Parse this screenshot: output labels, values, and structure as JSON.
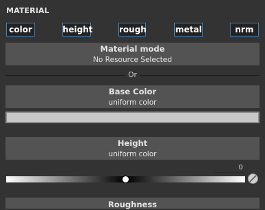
{
  "panel": {
    "title": "MATERIAL"
  },
  "channels": [
    {
      "label": "color"
    },
    {
      "label": "height"
    },
    {
      "label": "rough"
    },
    {
      "label": "metal"
    },
    {
      "label": "nrm"
    }
  ],
  "material_mode": {
    "title": "Material mode",
    "subtitle": "No Resource Selected"
  },
  "separator": {
    "label": "Or"
  },
  "base_color": {
    "title": "Base Color",
    "subtitle": "uniform color",
    "swatch": "#c7c7c7"
  },
  "height": {
    "title": "Height",
    "subtitle": "uniform color",
    "value": "0",
    "slider_fraction": 0.5
  },
  "roughness": {
    "title": "Roughness"
  },
  "colors": {
    "background": "#333333",
    "section": "#535353",
    "accent": "#3d84c6"
  }
}
